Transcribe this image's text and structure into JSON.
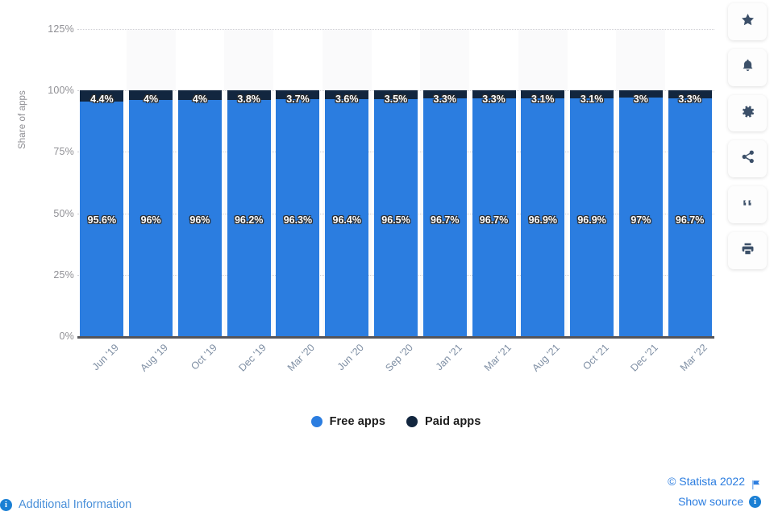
{
  "chart_data": {
    "type": "bar",
    "stacked": true,
    "title": "",
    "subtitle": "",
    "xlabel": "",
    "ylabel": "Share of apps",
    "ylim": [
      0,
      125
    ],
    "yticks": [
      "0%",
      "25%",
      "50%",
      "75%",
      "100%",
      "125%"
    ],
    "ytick_values": [
      0,
      25,
      50,
      75,
      100,
      125
    ],
    "grid": true,
    "legend_position": "bottom",
    "categories": [
      "Jun '19",
      "Aug '19",
      "Oct '19",
      "Dec '19",
      "Mar '20",
      "Jun '20",
      "Sep '20",
      "Jan '21",
      "Mar '21",
      "Aug '21",
      "Oct '21",
      "Dec '21",
      "Mar '22"
    ],
    "series": [
      {
        "name": "Free apps",
        "color": "#2b7de0",
        "values": [
          95.6,
          96,
          96,
          96.2,
          96.3,
          96.4,
          96.5,
          96.7,
          96.7,
          96.9,
          96.9,
          97,
          96.7
        ],
        "labels": [
          "95.6%",
          "96%",
          "96%",
          "96.2%",
          "96.3%",
          "96.4%",
          "96.5%",
          "96.7%",
          "96.7%",
          "96.9%",
          "96.9%",
          "97%",
          "96.7%"
        ]
      },
      {
        "name": "Paid apps",
        "color": "#12263f",
        "values": [
          4.4,
          4,
          4,
          3.8,
          3.7,
          3.6,
          3.5,
          3.3,
          3.3,
          3.1,
          3.1,
          3,
          3.3
        ],
        "labels": [
          "4.4%",
          "4%",
          "4%",
          "3.8%",
          "3.7%",
          "3.6%",
          "3.5%",
          "3.3%",
          "3.3%",
          "3.1%",
          "3.1%",
          "3%",
          "3.3%"
        ]
      }
    ]
  },
  "legend": {
    "items": [
      {
        "label": "Free apps",
        "color": "#2b7de0"
      },
      {
        "label": "Paid apps",
        "color": "#12263f"
      }
    ]
  },
  "footer": {
    "additional_information": "Additional Information",
    "copyright": "© Statista 2022",
    "show_source": "Show source",
    "info_glyph": "i"
  },
  "sidebar": {
    "items": [
      {
        "name": "star-icon",
        "tooltip": "Favorite"
      },
      {
        "name": "bell-icon",
        "tooltip": "Notifications"
      },
      {
        "name": "gear-icon",
        "tooltip": "Settings"
      },
      {
        "name": "share-icon",
        "tooltip": "Share"
      },
      {
        "name": "quote-icon",
        "tooltip": "Citation"
      },
      {
        "name": "print-icon",
        "tooltip": "Print"
      }
    ]
  },
  "colors": {
    "free": "#2b7de0",
    "paid": "#12263f",
    "link": "#2b7de0",
    "grid": "#cfcfd4",
    "band": "#fafafb",
    "axis": "#55555a"
  }
}
